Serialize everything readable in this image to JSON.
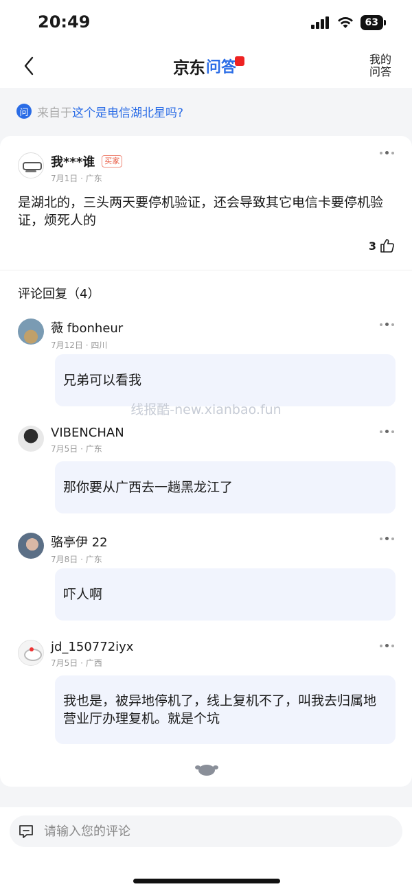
{
  "status_bar": {
    "time": "20:49",
    "battery": "63"
  },
  "nav": {
    "logo_jd": "京东",
    "logo_wenda": "问答",
    "my_qa": "我的问答"
  },
  "source": {
    "prefix": "来自于",
    "question": "这个是电信湖北星吗?"
  },
  "answer": {
    "author": "我***谁",
    "tag": "买家",
    "meta": "7月1日 · 广东",
    "text": "是湖北的，三头两天要停机验证，还会导致其它电信卡要停机验证，烦死人的",
    "likes": "3"
  },
  "replies": {
    "title": "评论回复（4）",
    "items": [
      {
        "author": "薇 fbonheur",
        "meta": "7月12日 · 四川",
        "text": "兄弟可以看我"
      },
      {
        "author": "VIBENCHAN",
        "meta": "7月5日 · 广东",
        "text": "那你要从广西去一趟黑龙江了"
      },
      {
        "author": "骆亭伊 22",
        "meta": "7月8日 · 广东",
        "text": "吓人啊"
      },
      {
        "author": "jd_150772iyx",
        "meta": "7月5日 · 广西",
        "text": "我也是，被异地停机了，线上复机不了，叫我去归属地营业厅办理复机。就是个坑"
      }
    ]
  },
  "watermark": "线报酷-new.xianbao.fun",
  "comment_input": {
    "placeholder": "请输入您的评论"
  },
  "colors": {
    "accent": "#2a6ce6",
    "bubble": "#f1f4fd",
    "buyer_tag": "#e85c44"
  }
}
